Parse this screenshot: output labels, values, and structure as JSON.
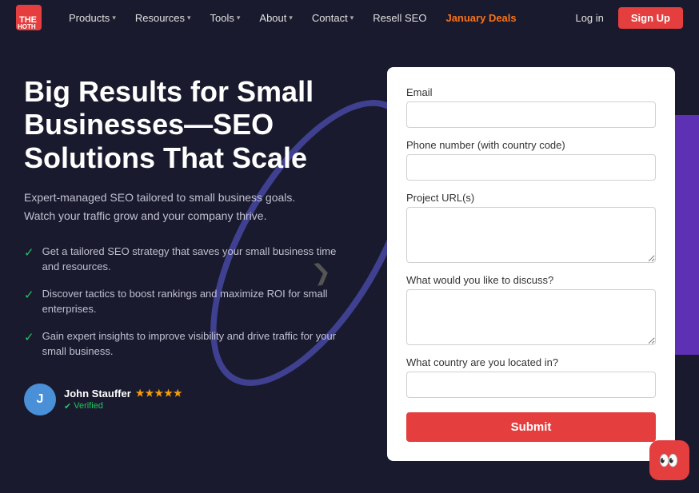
{
  "navbar": {
    "logo_text": "THEHOTH",
    "nav_items": [
      {
        "label": "Products",
        "has_dropdown": true
      },
      {
        "label": "Resources",
        "has_dropdown": true
      },
      {
        "label": "Tools",
        "has_dropdown": true
      },
      {
        "label": "About",
        "has_dropdown": true
      },
      {
        "label": "Contact",
        "has_dropdown": true
      },
      {
        "label": "Resell SEO",
        "has_dropdown": false
      },
      {
        "label": "January Deals",
        "has_dropdown": false,
        "highlight": true
      }
    ],
    "login_label": "Log in",
    "signup_label": "Sign Up"
  },
  "hero": {
    "title": "Big Results for Small Businesses—SEO Solutions That Scale",
    "subtitle": "Expert-managed SEO tailored to small business goals. Watch your traffic grow and your company thrive.",
    "bullets": [
      "Get a tailored SEO strategy that saves your small business time and resources.",
      "Discover tactics to boost rankings and maximize ROI for small enterprises.",
      "Gain expert insights to improve visibility and drive traffic for your small business."
    ],
    "reviewer": {
      "name": "John Stauffer",
      "verified_label": "Verified",
      "stars": "★★★★★"
    }
  },
  "form": {
    "email_label": "Email",
    "email_placeholder": "",
    "phone_label": "Phone number (with country code)",
    "phone_placeholder": "",
    "project_label": "Project URL(s)",
    "project_placeholder": "",
    "discuss_label": "What would you like to discuss?",
    "discuss_placeholder": "",
    "country_label": "What country are you located in?",
    "country_placeholder": "",
    "submit_label": "Submit"
  }
}
